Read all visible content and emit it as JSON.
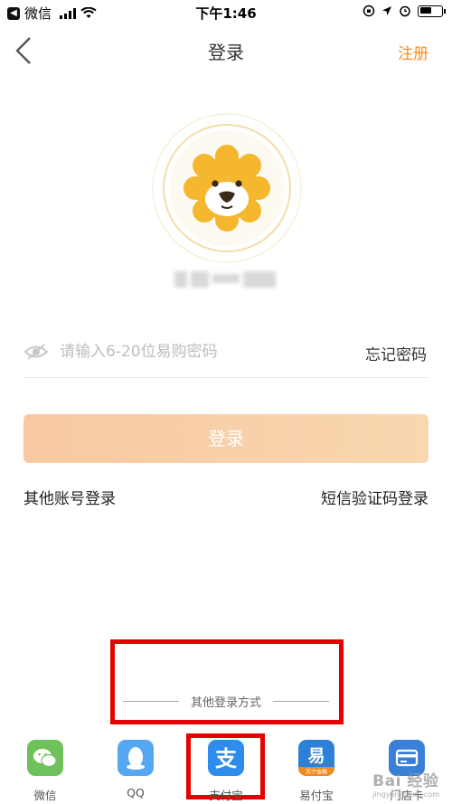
{
  "status_bar": {
    "carrier": "微信",
    "time": "下午1:46"
  },
  "nav": {
    "title": "登录",
    "register_label": "注册"
  },
  "password": {
    "placeholder": "请输入6-20位易购密码",
    "value": "",
    "forgot_label": "忘记密码"
  },
  "login_button": {
    "label": "登录"
  },
  "alt_links": {
    "other_account": "其他账号登录",
    "sms_login": "短信验证码登录"
  },
  "other_login": {
    "divider_text": "其他登录方式",
    "options": [
      {
        "label": "微信",
        "icon": "wechat-icon",
        "color": "#6fc15b"
      },
      {
        "label": "QQ",
        "icon": "qq-icon",
        "color": "#54a8ef"
      },
      {
        "label": "支付宝",
        "icon": "alipay-icon",
        "color": "#2e8cec"
      },
      {
        "label": "易付宝",
        "icon": "yifubao-icon",
        "color": "#2e7fd8",
        "badge": "苏宁金融"
      },
      {
        "label": "门店卡",
        "icon": "store-card-icon",
        "color": "#3a7fd8"
      }
    ]
  },
  "watermark": {
    "text": "Bai 经验",
    "sub": "jingyan.baidu.com"
  },
  "colors": {
    "accent": "#ff8a1a",
    "login_button": "#f8cfa8",
    "annotation": "#e60000",
    "mascot": "#f5b72e"
  }
}
